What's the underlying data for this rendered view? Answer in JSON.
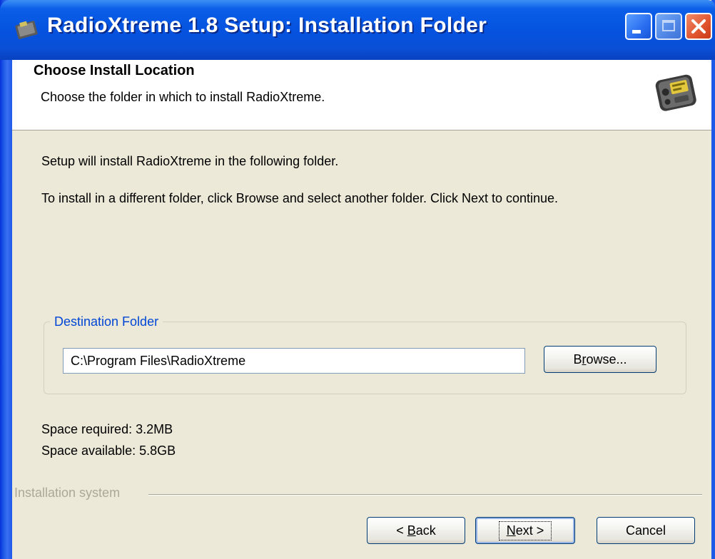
{
  "window": {
    "title": "RadioXtreme 1.8 Setup: Installation Folder",
    "title_icon": "installer-icon",
    "controls": [
      "minimize-icon",
      "maximize-icon",
      "close-icon"
    ]
  },
  "header": {
    "title": "Choose Install Location",
    "subtitle": "Choose the folder in which to install RadioXtreme.",
    "icon": "radio-device-icon"
  },
  "body": {
    "intro": "Setup will install RadioXtreme in the following folder.",
    "instructions": "To install in a different folder, click Browse and select another folder. Click Next to continue."
  },
  "destination": {
    "group_label": "Destination Folder",
    "path_value": "C:\\Program Files\\RadioXtreme",
    "browse_prefix": "B",
    "browse_mnemonic": "r",
    "browse_suffix": "owse..."
  },
  "space": {
    "required": "Space required: 3.2MB",
    "available": "Space available: 5.8GB"
  },
  "footer": {
    "label": "Installation system",
    "back_prefix": "< ",
    "back_mnemonic": "B",
    "back_suffix": "ack",
    "next_mnemonic": "N",
    "next_suffix": "ext >",
    "cancel": "Cancel"
  },
  "colors": {
    "titlebar": "#0553e0",
    "dialog_bg": "#ece9d8",
    "group_label": "#0046d5",
    "close_button": "#e0542e"
  }
}
